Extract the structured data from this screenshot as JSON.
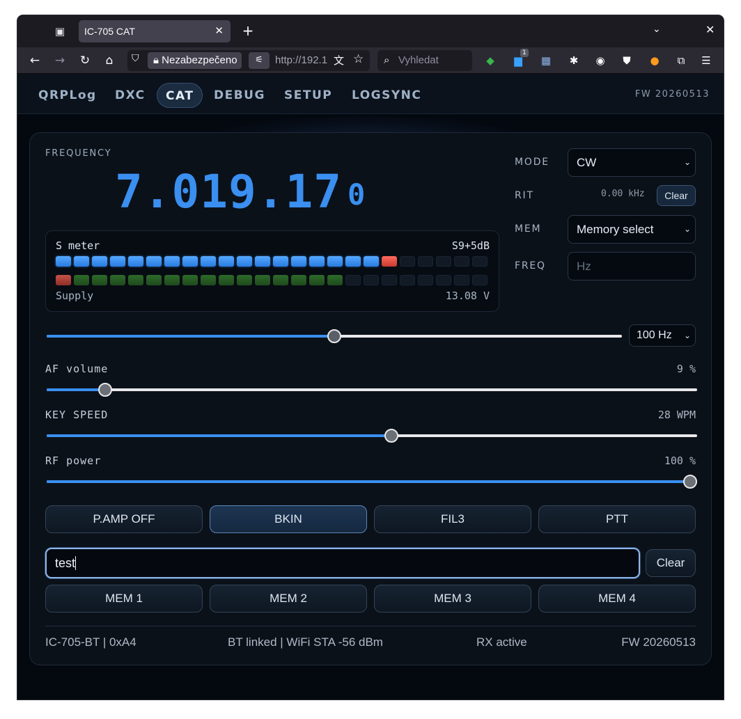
{
  "browser": {
    "tab_title": "IC-705 CAT",
    "security_label": "Nezabezpečeno",
    "url": "http://192.1",
    "search_placeholder": "Vyhledat",
    "extension_badge": "1"
  },
  "nav": {
    "items": [
      "QRPLog",
      "DXC",
      "CAT",
      "DEBUG",
      "SETUP",
      "LOGSYNC"
    ],
    "active": "CAT",
    "fw": "FW 20260513"
  },
  "frequency": {
    "label": "FREQUENCY",
    "mhz": "7",
    "khz": "019",
    "hz": "17",
    "tenths": "0"
  },
  "meter": {
    "s_label": "S meter",
    "s_value": "S9+5dB",
    "s_level_segments": 18,
    "s_peak_segment": 19,
    "supply_label": "Supply",
    "supply_value": "13.08 V",
    "supply_level_segments": 15,
    "total_segments": 24
  },
  "right_panel": {
    "mode_label": "MODE",
    "mode_value": "CW",
    "rit_label": "RIT",
    "rit_value": "0.00 kHz",
    "rit_clear": "Clear",
    "mem_label": "MEM",
    "mem_value": "Memory select",
    "freq_label": "FREQ",
    "freq_placeholder": "Hz"
  },
  "tuning": {
    "step_value": "100 Hz",
    "position_fraction": 0.5
  },
  "controls": {
    "af": {
      "label": "AF volume",
      "value": "9 %",
      "fraction": 0.09
    },
    "key": {
      "label": "KEY SPEED",
      "value": "28 WPM",
      "fraction": 0.53
    },
    "rf": {
      "label": "RF power",
      "value": "100 %",
      "fraction": 1.0
    }
  },
  "buttons": {
    "pamp": "P.AMP OFF",
    "bkin": "BKIN",
    "fil": "FIL3",
    "ptt": "PTT"
  },
  "message": {
    "text": "test",
    "clear": "Clear"
  },
  "memories": [
    "MEM 1",
    "MEM 2",
    "MEM 3",
    "MEM 4"
  ],
  "footer": {
    "device": "IC-705-BT | 0xA4",
    "link": "BT linked | WiFi STA -56 dBm",
    "status": "RX active",
    "fw": "FW 20260513"
  }
}
